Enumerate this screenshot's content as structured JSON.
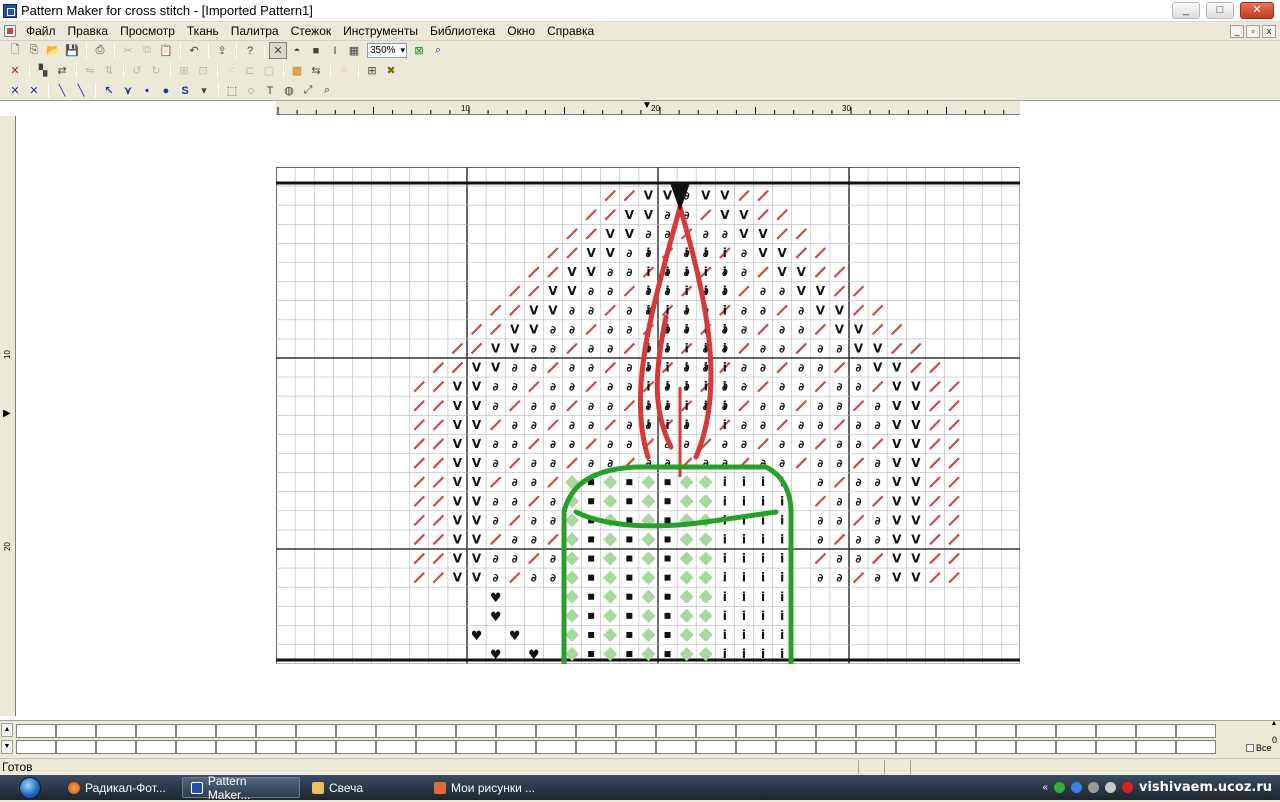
{
  "window": {
    "title": "Pattern Maker for cross stitch - [Imported Pattern1]",
    "minimize": "_",
    "maximize": "□",
    "close": "✕"
  },
  "menu": {
    "items": [
      "Файл",
      "Правка",
      "Просмотр",
      "Ткань",
      "Палитра",
      "Стежок",
      "Инструменты",
      "Библиотека",
      "Окно",
      "Справка"
    ],
    "mdi_min": "_",
    "mdi_restore": "▫",
    "mdi_close": "x"
  },
  "toolbar": {
    "zoom": "350%"
  },
  "ruler": {
    "h_labels": [
      "10",
      "20",
      "30"
    ],
    "v_labels": [
      "10",
      "20"
    ]
  },
  "palette": {
    "show_all_label": "Все",
    "count": "0"
  },
  "status": {
    "text": "Готов"
  },
  "taskbar": {
    "tasks": [
      "Радикал-Фот...",
      "Pattern Maker...",
      "Свеча",
      "Мои рисунки ..."
    ],
    "watermark": "vishivaem.ucoz.ru"
  },
  "colors": {
    "red_stitch": "#d04848",
    "green_outline": "#28a028",
    "black_symbol": "#111111",
    "light_green": "#a8d8a0"
  }
}
